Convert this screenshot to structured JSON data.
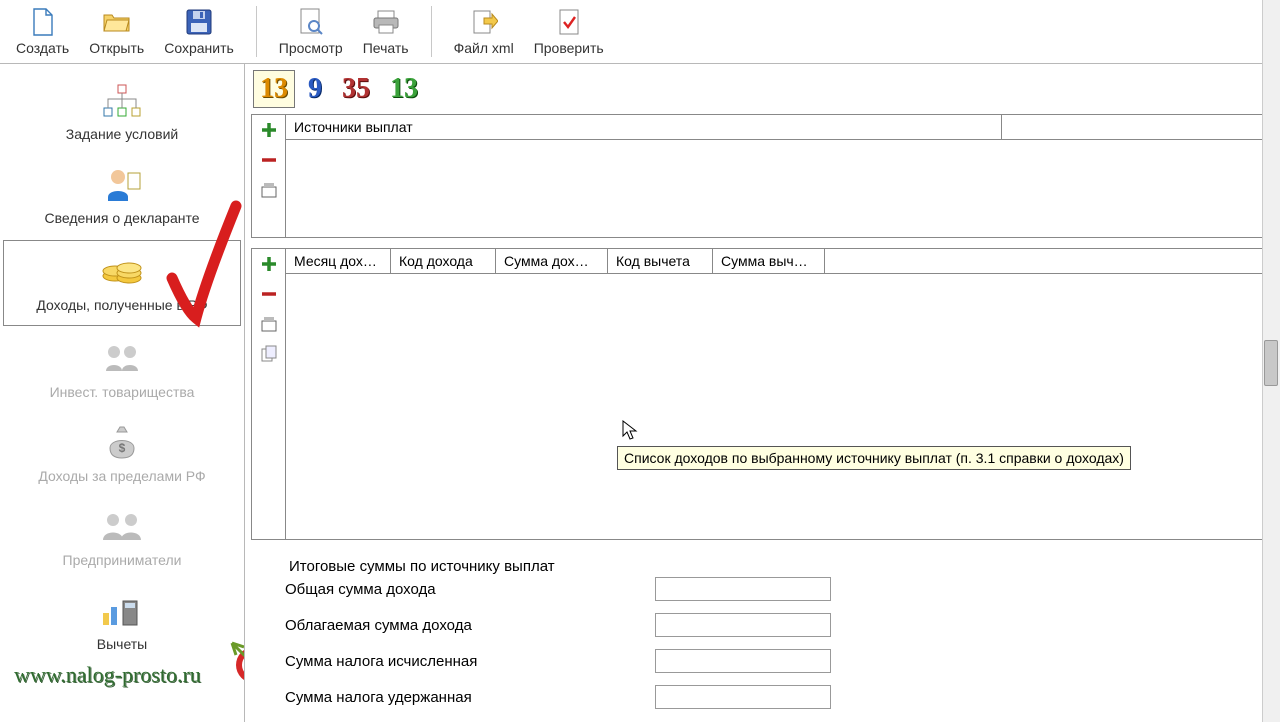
{
  "toolbar": {
    "create": "Создать",
    "open": "Открыть",
    "save": "Сохранить",
    "preview": "Просмотр",
    "print": "Печать",
    "xml": "Файл xml",
    "check": "Проверить"
  },
  "sidebar": {
    "items": [
      {
        "label": "Задание условий"
      },
      {
        "label": "Сведения о декларанте"
      },
      {
        "label": "Доходы, полученные в РФ"
      },
      {
        "label": "Инвест. товарищества"
      },
      {
        "label": "Доходы за пределами РФ"
      },
      {
        "label": "Предприниматели"
      },
      {
        "label": "Вычеты"
      }
    ]
  },
  "rates": {
    "r13": "13",
    "r9": "9",
    "r35": "35",
    "r13g": "13"
  },
  "sources_header": "Источники выплат",
  "income_cols": {
    "c1": "Месяц дох…",
    "c2": "Код дохода",
    "c3": "Сумма дох…",
    "c4": "Код вычета",
    "c5": "Сумма выч…"
  },
  "tooltip": "Список доходов по выбранному источнику выплат (п. 3.1 справки о доходах)",
  "totals": {
    "legend": "Итоговые суммы по источнику выплат",
    "total_income": "Общая сумма дохода",
    "taxable_income": "Облагаемая сумма дохода",
    "tax_calc": "Сумма налога исчисленная",
    "tax_withheld": "Сумма налога удержанная",
    "v1": "",
    "v2": "",
    "v3": "",
    "v4": ""
  },
  "watermark": "www.nalog-prosto.ru"
}
